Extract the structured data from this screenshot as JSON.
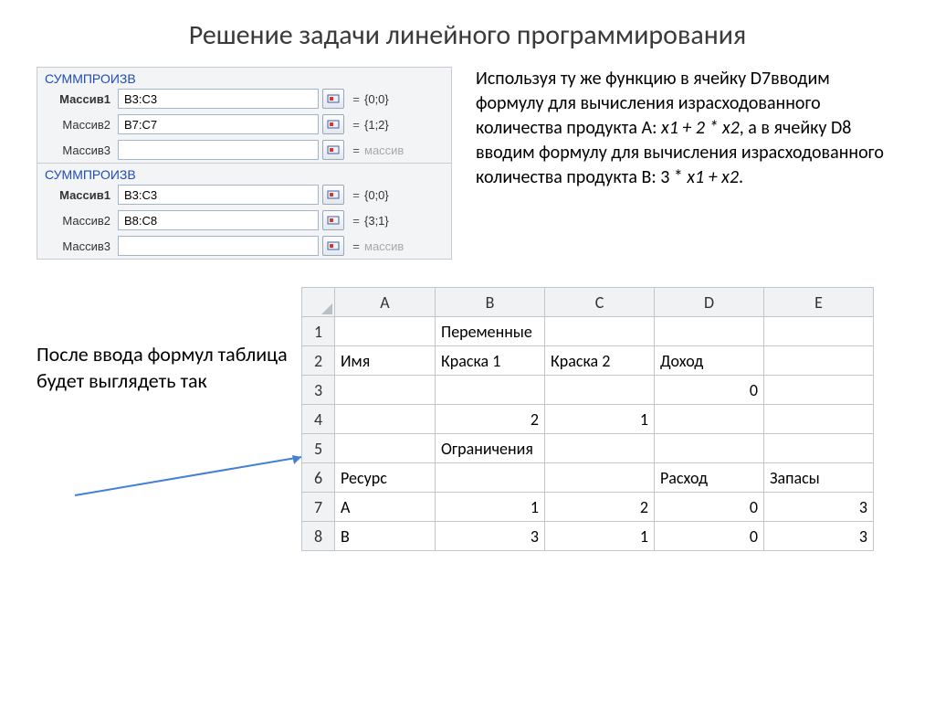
{
  "title": "Решение задачи линейного программирования",
  "dialogs": [
    {
      "name": "СУММПРОИЗВ",
      "rows": [
        {
          "label": "Массив1",
          "bold": true,
          "value": "B3:C3",
          "result": "{0;0}",
          "dim": false
        },
        {
          "label": "Массив2",
          "bold": false,
          "value": "B7:C7",
          "result": "{1;2}",
          "dim": false
        },
        {
          "label": "Массив3",
          "bold": false,
          "value": "",
          "result": "массив",
          "dim": true
        }
      ]
    },
    {
      "name": "СУММПРОИЗВ",
      "rows": [
        {
          "label": "Массив1",
          "bold": true,
          "value": "B3:C3",
          "result": "{0;0}",
          "dim": false
        },
        {
          "label": "Массив2",
          "bold": false,
          "value": "B8:C8",
          "result": "{3;1}",
          "dim": false
        },
        {
          "label": "Массив3",
          "bold": false,
          "value": "",
          "result": "массив",
          "dim": true
        }
      ]
    }
  ],
  "description": {
    "p1a": "Используя ту же функцию в ячейку D7вводим формулу для вычисления израсходованного количества продукта А: ",
    "f1": "x1 + 2 * x2",
    "p1b": ", а в ячейку D8 вводим формулу для вычисления израсходованного количества продукта В: 3 * ",
    "f2": "x1 + x2",
    "p1c": "."
  },
  "note": "После ввода формул таблица будет выглядеть так",
  "sheet": {
    "cols": [
      "A",
      "B",
      "C",
      "D",
      "E"
    ],
    "rows": [
      {
        "n": "1",
        "A": "",
        "B": "Переменные",
        "C": "",
        "D": "",
        "E": ""
      },
      {
        "n": "2",
        "A": "Имя",
        "B": "Краска 1",
        "C": "Краска 2",
        "D": "Доход",
        "E": ""
      },
      {
        "n": "3",
        "A": "",
        "B": "",
        "C": "",
        "D": "0",
        "E": "",
        "D_r": true
      },
      {
        "n": "4",
        "A": "",
        "B": "2",
        "C": "1",
        "D": "",
        "E": "",
        "B_r": true,
        "C_r": true
      },
      {
        "n": "5",
        "A": "",
        "B": "Ограничения",
        "C": "",
        "D": "",
        "E": ""
      },
      {
        "n": "6",
        "A": "Ресурс",
        "B": "",
        "C": "",
        "D": "Расход",
        "E": "Запасы"
      },
      {
        "n": "7",
        "A": "A",
        "B": "1",
        "C": "2",
        "D": "0",
        "E": "3",
        "B_r": true,
        "C_r": true,
        "D_r": true,
        "E_r": true
      },
      {
        "n": "8",
        "A": "B",
        "B": "3",
        "C": "1",
        "D": "0",
        "E": "3",
        "B_r": true,
        "C_r": true,
        "D_r": true,
        "E_r": true
      }
    ]
  }
}
